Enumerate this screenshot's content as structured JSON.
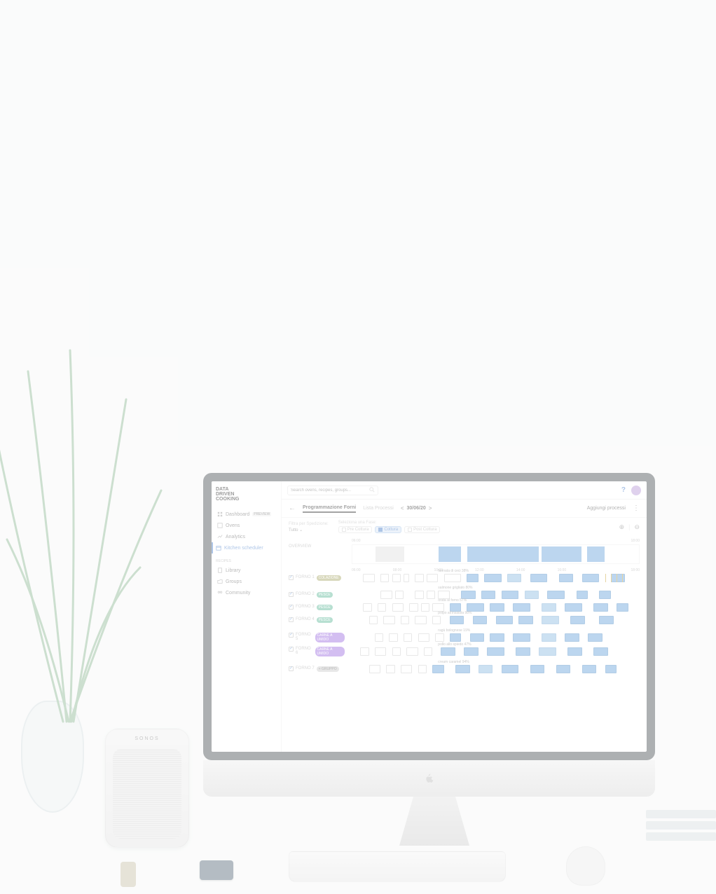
{
  "logo": "DATA\nDRIVEN\nCOOKING",
  "sidebar": {
    "items": [
      {
        "label": "Dashboard",
        "badge": "PREVIEW"
      },
      {
        "label": "Ovens"
      },
      {
        "label": "Analytics"
      },
      {
        "label": "Kitchen scheduler"
      }
    ],
    "recipes_header": "RECIPES",
    "recipes": [
      {
        "label": "Library"
      },
      {
        "label": "Groups"
      },
      {
        "label": "Community"
      }
    ]
  },
  "search": {
    "placeholder": "Search ovens, recipes, groups..."
  },
  "subheader": {
    "tab1": "Programmazione Forni",
    "tab2": "Lista Processi",
    "date": "30/06/20",
    "add": "Aggiungi processi"
  },
  "filters": {
    "ship_label": "Filtra per Spedizione:",
    "ship_value": "Tutto",
    "phase_label": "Seleziona una Fase:",
    "pre": "Pre Cottura",
    "cook": "Cottura",
    "post": "Post Cottura"
  },
  "overview": {
    "label": "OVERVIEW",
    "hours_top": [
      "06:00",
      "18:00"
    ],
    "hours": [
      "06:00",
      "08:00",
      "10:00",
      "12:00",
      "14:00",
      "16:00",
      "18:00"
    ]
  },
  "ovens": [
    {
      "name": "Forno 1",
      "tag": "Colazione",
      "tagClass": "olive",
      "recipe": "farinata di ceci 38%"
    },
    {
      "name": "Forno 2",
      "tag": "Pesce",
      "tagClass": "green",
      "recipe": "salmone grigliato 80%"
    },
    {
      "name": "Forno 3",
      "tag": "Pesce",
      "tagClass": "green",
      "recipe": "orata al forno 57%"
    },
    {
      "name": "Forno 4",
      "tag": "Pesce",
      "tagClass": "green",
      "recipe": "polpo all'insalata 98%"
    },
    {
      "name": "Forno 5",
      "tag": "Carne a umido",
      "tagClass": "purple",
      "recipe": "ragù bolognese 19%"
    },
    {
      "name": "Forno 6",
      "tag": "Carne a umido",
      "tagClass": "purple",
      "recipe": "pollo allo spiedo 47%"
    },
    {
      "name": "Forno 7",
      "tag": "+ Gruppo",
      "tagClass": "gray",
      "recipe": "cream caramel 94%"
    }
  ],
  "colors": {
    "accent": "#4a7fc9",
    "blue": "#6ba5dc",
    "purple": "#9d6fe0",
    "green": "#5fb89a"
  }
}
